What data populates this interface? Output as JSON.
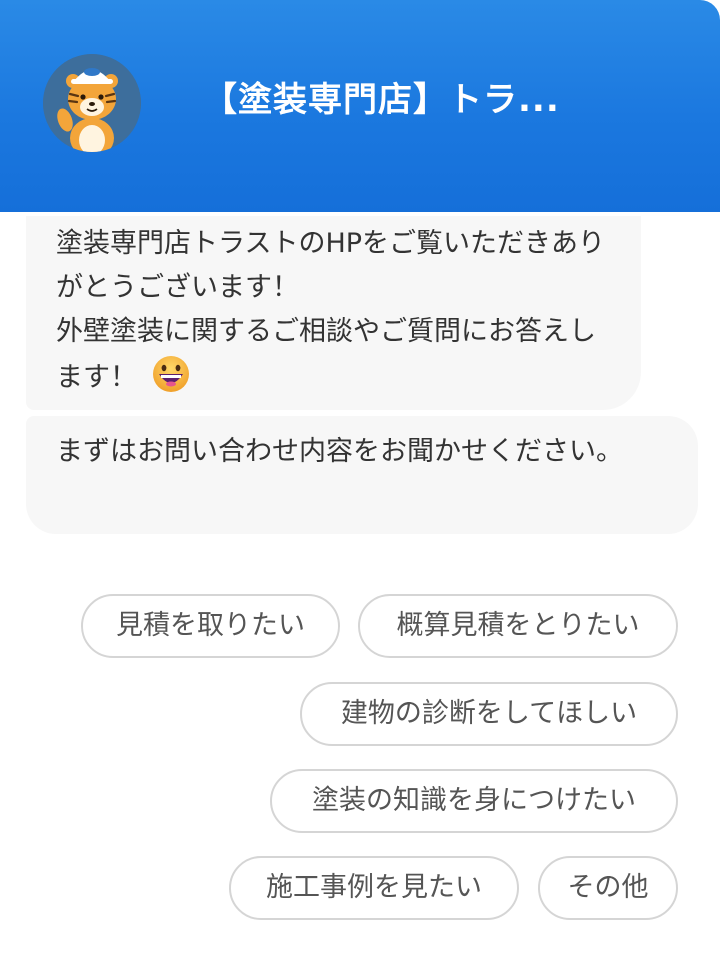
{
  "header": {
    "title": "【塗装専門店】トラ...",
    "avatar_icon": "tiger-mascot-icon"
  },
  "messages": [
    {
      "text": "塗装専門店トラストのHPをご覧いただきありがとうございます！\n外壁塗装に関するご相談やご質問にお答えします！",
      "emoji": "grinning-face-icon"
    },
    {
      "text": "まずはお問い合わせ内容をお聞かせください。"
    }
  ],
  "quick_replies": [
    "見積を取りたい",
    "概算見積をとりたい",
    "建物の診断をしてほしい",
    "塗装の知識を身につけたい",
    "施工事例を見たい",
    "その他"
  ],
  "colors": {
    "header_blue": "#1b78df",
    "bubble_bg": "#f7f7f7",
    "chip_border": "#d5d5d5"
  }
}
